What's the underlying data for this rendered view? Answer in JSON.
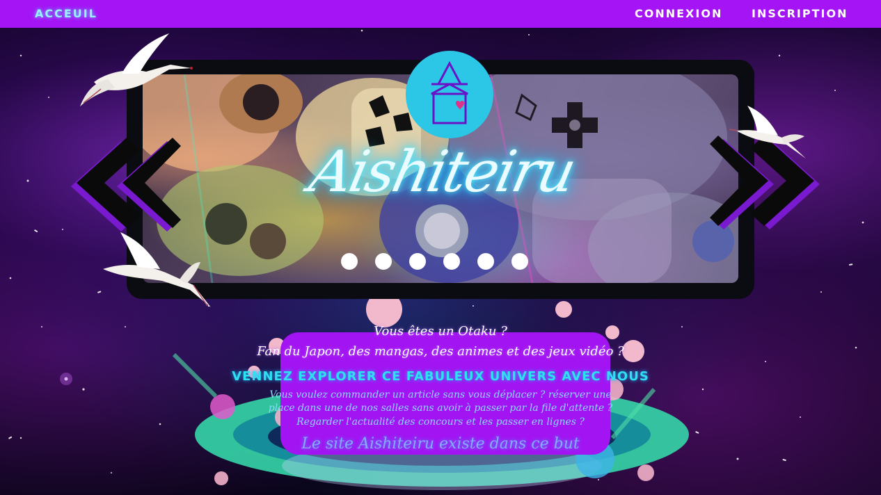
{
  "nav": {
    "home_label": "ACCEUIL",
    "login_label": "CONNEXION",
    "register_label": "INSCRIPTION"
  },
  "slider": {
    "logo_text": "Aishiteiru",
    "dot_count": 6,
    "active_dot": 0
  },
  "intro": {
    "question_otaku": "Vous êtes un Otaku ?",
    "question_fan": "Fan du Japon, des mangas, des animes et des jeux vidéo ?",
    "tagline": "VENNEZ EXPLORER CE FABULEUX UNIVERS AVEC NOUS",
    "desc_line1": "Vous voulez commander un article sans vous déplacer ? réserver une",
    "desc_line2": "place dans une de nos salles sans avoir à passer par la file d'attente ?",
    "desc_line3": "Regarder l'actualité des concours et les passer en lignes ?",
    "closing": "Le site Aishiteiru existe dans ce but"
  },
  "colors": {
    "navbar": "#a414f5",
    "text_box": "#a314f2",
    "logo_circle": "#2cc6e6",
    "tagline": "#2ee0f0",
    "arrow": "#7a1ad0"
  },
  "icons": {
    "prev": "double-chevron-left-icon",
    "next": "double-chevron-right-icon",
    "logo": "house-triangle-logo-icon",
    "decoration": "crane-bird-icon"
  }
}
